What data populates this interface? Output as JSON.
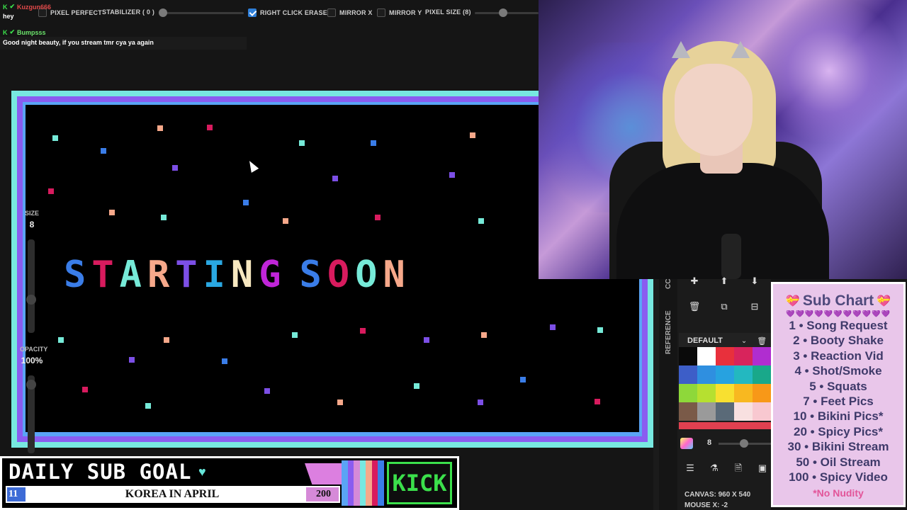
{
  "toolbar": {
    "pixel_perfect": "PIXEL PERFECT",
    "stabilizer": "STABILIZER ( 0 )",
    "right_click_erase": "RIGHT CLICK ERASE",
    "mirror_x": "MIRROR X",
    "mirror_y": "MIRROR Y",
    "pixel_size": "PIXEL SIZE (8)"
  },
  "chat": [
    {
      "user": "Kuzgun666",
      "color": "#e24a4a",
      "message": "hey"
    },
    {
      "user": "Bumpsss",
      "color": "#6be36b",
      "message": "Good night beauty, if you stream tmr cya ya again"
    }
  ],
  "left_tools": {
    "size_label": "SIZE",
    "size_value": "8",
    "opacity_label": "OPACITY",
    "opacity_value": "100%"
  },
  "canvas": {
    "title": "STARTING SOON",
    "title_colors": [
      "#3a7de8",
      "#d81b5e",
      "#76ead8",
      "#f6a88a",
      "#7c4fe6",
      "#2aa8e2",
      "#f7e8c0",
      "#c025d8",
      "#3a7de8",
      "#d81b5e",
      "#76ead8",
      "#f6a88a"
    ]
  },
  "right_panel": {
    "tab_reference": "REFERENCE",
    "tab_cc": "CC",
    "palette_name": "DEFAULT",
    "brush_size": "8",
    "canvas_size": "CANVAS: 960 X 540",
    "mouse_pos": "MOUSE X: -2",
    "swatches": [
      "#0a0a0a",
      "#ffffff",
      "#e8303c",
      "#d8245c",
      "#b02dd0",
      "#3d5ec8",
      "#2f8fe0",
      "#27a2e0",
      "#23b8c0",
      "#19a88a",
      "#8ed83a",
      "#b6e030",
      "#f8e030",
      "#f8b820",
      "#f89818",
      "#7a5a48",
      "#9a9a9a",
      "#5a6a78",
      "#f8e0e0",
      "#f8c8d0"
    ]
  },
  "sub_chart": {
    "title": "Sub Chart",
    "hearts": "💜💜💜💜💜💜💜💜💜💜💜",
    "items": [
      "1 • Song Request",
      "2 • Booty Shake",
      "3 • Reaction Vid",
      "4 • Shot/Smoke",
      "5 • Squats",
      "7 • Feet Pics",
      "10 • Bikini Pics*",
      "20 • Spicy Pics*",
      "30 • Bikini Stream",
      "50 • Oil Stream",
      "100 • Spicy Video"
    ],
    "note": "*No Nudity"
  },
  "goal": {
    "title": "DAILY SUB GOAL",
    "text": "KOREA IN APRIL",
    "current": "11",
    "target": "200",
    "progress": 0.055,
    "kick_label": "KICK",
    "stripe_colors": [
      "#5aa4f5",
      "#8a5cf0",
      "#d68ad8",
      "#77e8e0",
      "#f6a88a",
      "#d81b5e",
      "#3a7de8"
    ]
  }
}
